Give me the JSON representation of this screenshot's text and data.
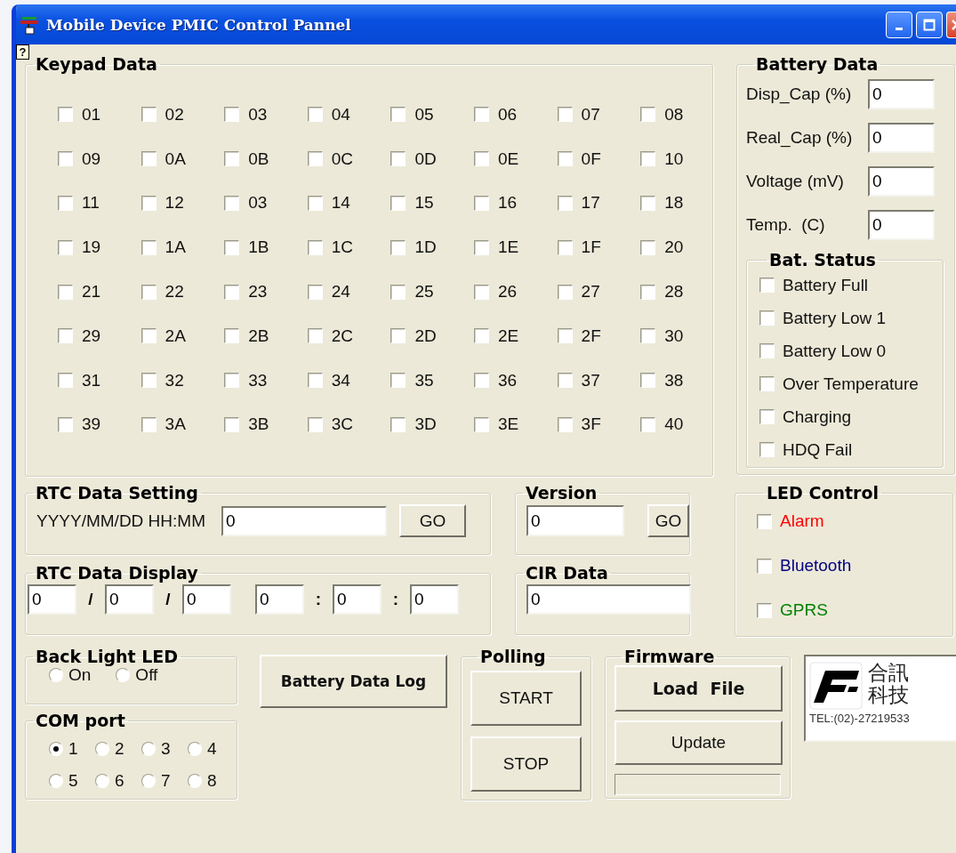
{
  "window": {
    "title": "Mobile Device PMIC Control Pannel"
  },
  "help": {
    "glyph": "?"
  },
  "keypad": {
    "title": "Keypad Data",
    "keys": [
      {
        "label": "01",
        "checked": false
      },
      {
        "label": "02",
        "checked": false
      },
      {
        "label": "03",
        "checked": false
      },
      {
        "label": "04",
        "checked": false
      },
      {
        "label": "05",
        "checked": false
      },
      {
        "label": "06",
        "checked": false
      },
      {
        "label": "07",
        "checked": false
      },
      {
        "label": "08",
        "checked": false
      },
      {
        "label": "09",
        "checked": false
      },
      {
        "label": "0A",
        "checked": false
      },
      {
        "label": "0B",
        "checked": false
      },
      {
        "label": "0C",
        "checked": false
      },
      {
        "label": "0D",
        "checked": false
      },
      {
        "label": "0E",
        "checked": false
      },
      {
        "label": "0F",
        "checked": false
      },
      {
        "label": "10",
        "checked": false
      },
      {
        "label": "11",
        "checked": false
      },
      {
        "label": "12",
        "checked": false
      },
      {
        "label": "03",
        "checked": false
      },
      {
        "label": "14",
        "checked": false
      },
      {
        "label": "15",
        "checked": false
      },
      {
        "label": "16",
        "checked": false
      },
      {
        "label": "17",
        "checked": false
      },
      {
        "label": "18",
        "checked": false
      },
      {
        "label": "19",
        "checked": false
      },
      {
        "label": "1A",
        "checked": false
      },
      {
        "label": "1B",
        "checked": false
      },
      {
        "label": "1C",
        "checked": false
      },
      {
        "label": "1D",
        "checked": false
      },
      {
        "label": "1E",
        "checked": false
      },
      {
        "label": "1F",
        "checked": false
      },
      {
        "label": "20",
        "checked": false
      },
      {
        "label": "21",
        "checked": false
      },
      {
        "label": "22",
        "checked": false
      },
      {
        "label": "23",
        "checked": false
      },
      {
        "label": "24",
        "checked": false
      },
      {
        "label": "25",
        "checked": false
      },
      {
        "label": "26",
        "checked": false
      },
      {
        "label": "27",
        "checked": false
      },
      {
        "label": "28",
        "checked": false
      },
      {
        "label": "29",
        "checked": false
      },
      {
        "label": "2A",
        "checked": false
      },
      {
        "label": "2B",
        "checked": false
      },
      {
        "label": "2C",
        "checked": false
      },
      {
        "label": "2D",
        "checked": false
      },
      {
        "label": "2E",
        "checked": false
      },
      {
        "label": "2F",
        "checked": false
      },
      {
        "label": "30",
        "checked": false
      },
      {
        "label": "31",
        "checked": false
      },
      {
        "label": "32",
        "checked": false
      },
      {
        "label": "33",
        "checked": false
      },
      {
        "label": "34",
        "checked": false
      },
      {
        "label": "35",
        "checked": false
      },
      {
        "label": "36",
        "checked": false
      },
      {
        "label": "37",
        "checked": false
      },
      {
        "label": "38",
        "checked": false
      },
      {
        "label": "39",
        "checked": false
      },
      {
        "label": "3A",
        "checked": false
      },
      {
        "label": "3B",
        "checked": false
      },
      {
        "label": "3C",
        "checked": false
      },
      {
        "label": "3D",
        "checked": false
      },
      {
        "label": "3E",
        "checked": false
      },
      {
        "label": "3F",
        "checked": false
      },
      {
        "label": "40",
        "checked": false
      }
    ]
  },
  "battery_data": {
    "title": "Battery Data",
    "fields": [
      {
        "label": "Disp_Cap (%)",
        "value": "0"
      },
      {
        "label": "Real_Cap (%)",
        "value": "0"
      },
      {
        "label": "Voltage (mV)",
        "value": "0"
      },
      {
        "label": "Temp.  (C)",
        "value": "0"
      }
    ],
    "status": {
      "title": "Bat. Status",
      "items": [
        {
          "label": "Battery Full",
          "checked": false
        },
        {
          "label": "Battery Low 1",
          "checked": false
        },
        {
          "label": "Battery Low 0",
          "checked": false
        },
        {
          "label": "Over Temperature",
          "checked": false
        },
        {
          "label": "Charging",
          "checked": false
        },
        {
          "label": "HDQ Fail",
          "checked": false
        }
      ]
    }
  },
  "rtc_setting": {
    "title": "RTC Data Setting",
    "label": "YYYY/MM/DD HH:MM",
    "value": "0",
    "button": "GO"
  },
  "version": {
    "title": "Version",
    "value": "0",
    "button": "GO"
  },
  "led_control": {
    "title": "LED Control",
    "items": [
      {
        "label": "Alarm",
        "checked": false,
        "color": "#ff0000"
      },
      {
        "label": "Bluetooth",
        "checked": false,
        "color": "#000080"
      },
      {
        "label": "GPRS",
        "checked": false,
        "color": "#008000"
      }
    ]
  },
  "rtc_display": {
    "title": "RTC Data Display",
    "fields": [
      {
        "value": "0",
        "separator": "/"
      },
      {
        "value": "0",
        "separator": "/"
      },
      {
        "value": "0"
      },
      {
        "value": "0",
        "separator": ":"
      },
      {
        "value": "0",
        "separator": ":"
      },
      {
        "value": "0"
      }
    ]
  },
  "cir_data": {
    "title": "CIR Data",
    "value": "0"
  },
  "back_light_led": {
    "title": "Back Light LED",
    "options": [
      {
        "label": "On",
        "selected": false
      },
      {
        "label": "Off",
        "selected": false
      }
    ]
  },
  "com_port": {
    "title": "COM port",
    "options": [
      {
        "label": "1",
        "selected": true
      },
      {
        "label": "2",
        "selected": false
      },
      {
        "label": "3",
        "selected": false
      },
      {
        "label": "4",
        "selected": false
      },
      {
        "label": "5",
        "selected": false
      },
      {
        "label": "6",
        "selected": false
      },
      {
        "label": "7",
        "selected": false
      },
      {
        "label": "8",
        "selected": false
      }
    ]
  },
  "battery_log_button": "Battery Data Log",
  "polling": {
    "title": "Polling",
    "buttons": [
      "START",
      "STOP"
    ]
  },
  "firmware": {
    "title": "Firmware",
    "buttons": [
      "Load  File",
      "Update"
    ],
    "progress": {
      "level": 0
    }
  },
  "logo": {
    "company": "合訊科技",
    "tel": "TEL:(02)-27219533"
  }
}
